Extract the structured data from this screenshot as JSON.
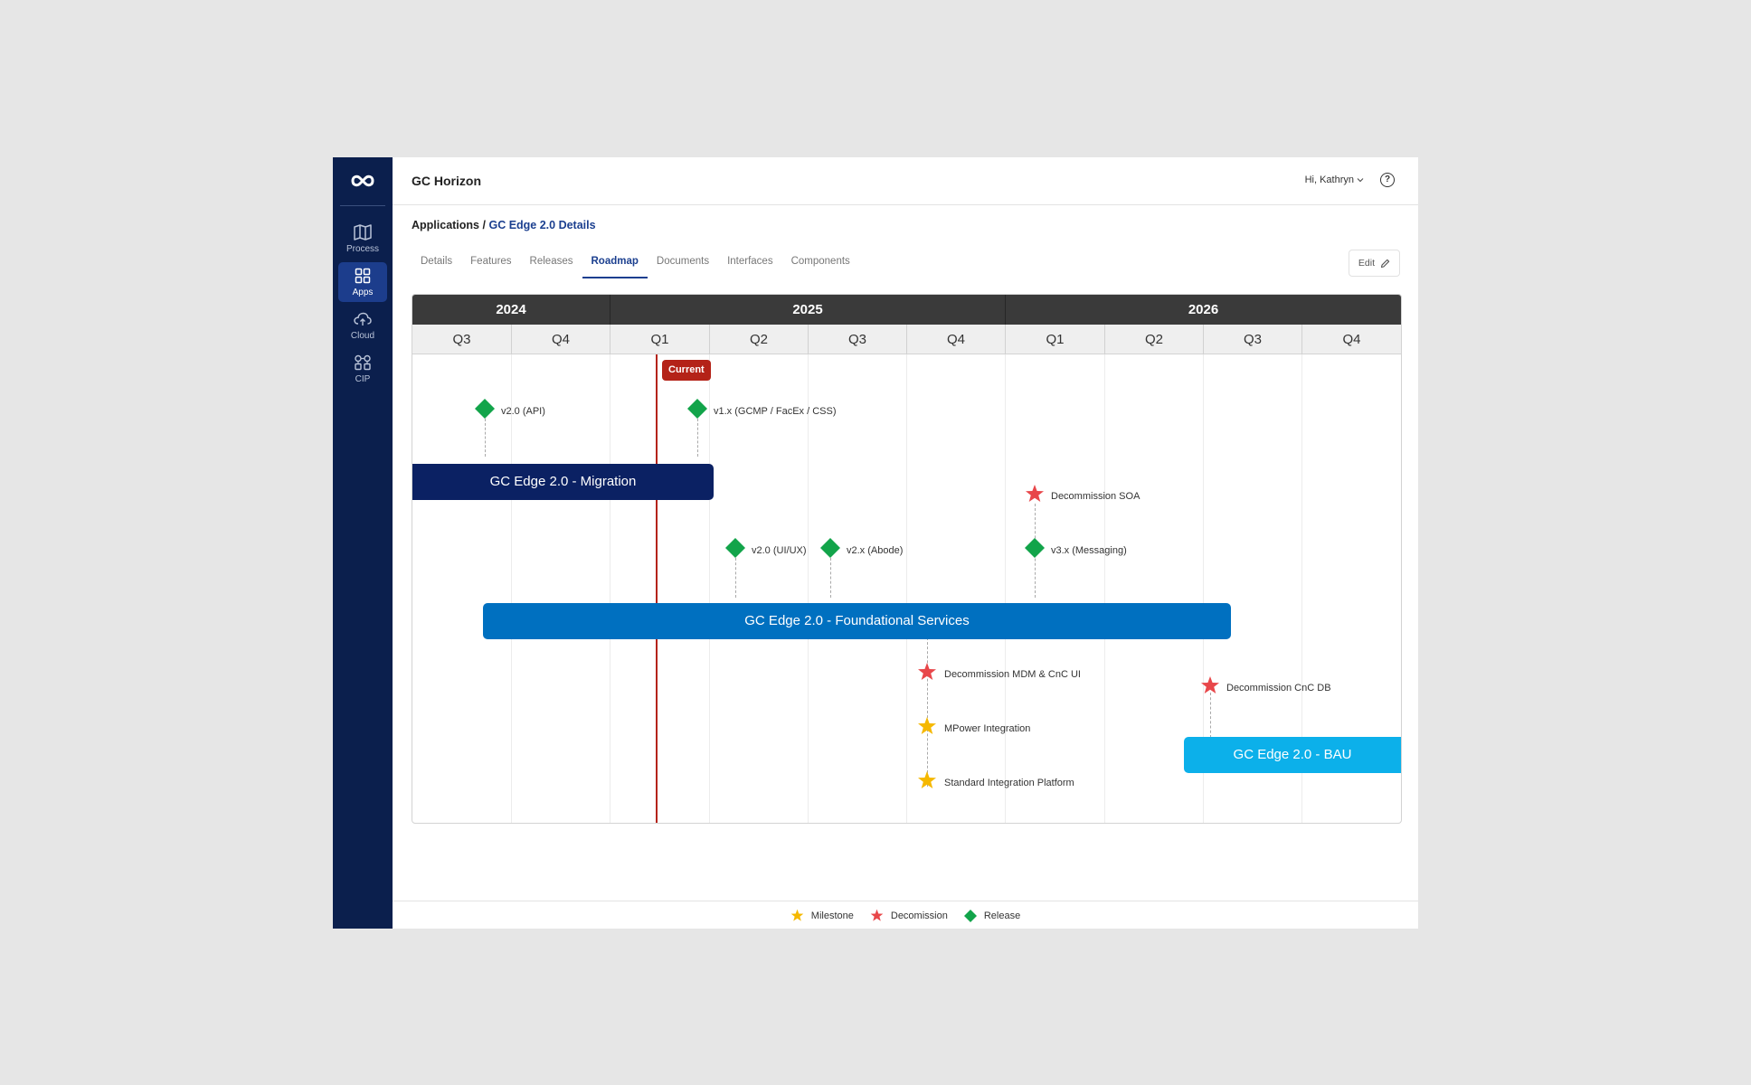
{
  "app": {
    "title": "GC Horizon"
  },
  "user": {
    "greeting": "Hi, Kathryn",
    "help_label": "?"
  },
  "sidebar": {
    "items": [
      {
        "label": "Process",
        "icon": "map-icon"
      },
      {
        "label": "Apps",
        "icon": "grid-icon",
        "active": true
      },
      {
        "label": "Cloud",
        "icon": "cloud-icon"
      },
      {
        "label": "CIP",
        "icon": "modules-icon"
      }
    ]
  },
  "breadcrumb": {
    "parent": "Applications",
    "separator": "/",
    "current": "GC Edge 2.0 Details"
  },
  "tabs": [
    {
      "label": "Details"
    },
    {
      "label": "Features"
    },
    {
      "label": "Releases"
    },
    {
      "label": "Roadmap",
      "active": true
    },
    {
      "label": "Documents"
    },
    {
      "label": "Interfaces"
    },
    {
      "label": "Components"
    }
  ],
  "edit_button": {
    "label": "Edit"
  },
  "roadmap": {
    "years": [
      "2024",
      "2025",
      "2026"
    ],
    "quarters": [
      "Q3",
      "Q4",
      "Q1",
      "Q2",
      "Q3",
      "Q4",
      "Q1",
      "Q2",
      "Q3",
      "Q4"
    ],
    "current_label": "Current",
    "bars": [
      {
        "label": "GC Edge 2.0 - Migration",
        "color": "#0b2163"
      },
      {
        "label": "GC Edge 2.0 - Foundational Services",
        "color": "#0070c0"
      },
      {
        "label": "GC Edge 2.0 - BAU",
        "color": "#0cb0ea"
      }
    ],
    "markers": [
      {
        "type": "release",
        "label": "v2.0 (API)"
      },
      {
        "type": "release",
        "label": "v1.x (GCMP / FacEx / CSS)"
      },
      {
        "type": "decommission",
        "label": "Decommission SOA"
      },
      {
        "type": "release",
        "label": "v2.0 (UI/UX)"
      },
      {
        "type": "release",
        "label": "v2.x (Abode)"
      },
      {
        "type": "release",
        "label": "v3.x (Messaging)"
      },
      {
        "type": "decommission",
        "label": "Decommission MDM & CnC UI"
      },
      {
        "type": "milestone",
        "label": "MPower Integration"
      },
      {
        "type": "milestone",
        "label": "Standard Integration Platform"
      },
      {
        "type": "decommission",
        "label": "Decommission CnC DB"
      }
    ]
  },
  "legend": [
    {
      "type": "milestone",
      "label": "Milestone"
    },
    {
      "type": "decommission",
      "label": "Decomission"
    },
    {
      "type": "release",
      "label": "Release"
    }
  ],
  "colors": {
    "milestone": "#f5b800",
    "decommission": "#e8474a",
    "release": "#12a44a",
    "current": "#b42318",
    "sidebar": "#0b1f4d"
  }
}
